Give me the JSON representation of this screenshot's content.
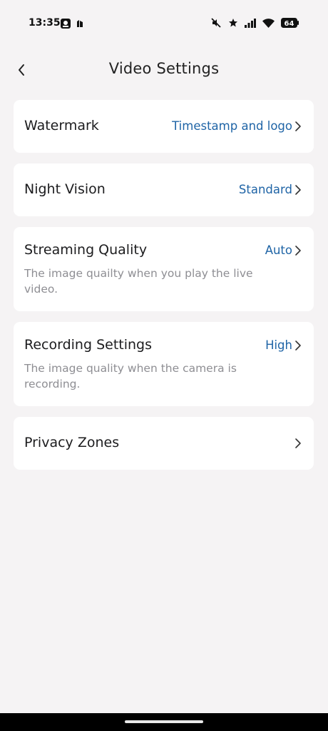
{
  "status_bar": {
    "time": "13:35",
    "battery": "64",
    "icons": [
      "photo-icon",
      "notification-icon",
      "mute-icon",
      "star-icon",
      "signal-icon",
      "wifi-icon",
      "battery-icon"
    ]
  },
  "header": {
    "title": "Video Settings",
    "back_icon": "chevron-left-icon"
  },
  "settings": [
    {
      "title": "Watermark",
      "value": "Timestamp and logo",
      "description": ""
    },
    {
      "title": "Night Vision",
      "value": "Standard",
      "description": ""
    },
    {
      "title": "Streaming Quality",
      "value": "Auto",
      "description": "The image quailty when you play the live video."
    },
    {
      "title": "Recording Settings",
      "value": "High",
      "description": "The image quality when the camera is recording."
    },
    {
      "title": "Privacy Zones",
      "value": "",
      "description": ""
    }
  ],
  "colors": {
    "background": "#f5f3f4",
    "card": "#ffffff",
    "accent": "#1f64a6",
    "secondary_text": "#8e8e93"
  }
}
